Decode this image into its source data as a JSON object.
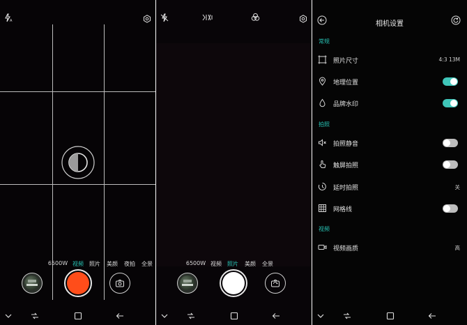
{
  "viewfinder_left": {
    "modes": [
      "6500W",
      "视频",
      "照片",
      "美颜",
      "夜拍",
      "全景"
    ],
    "active_mode": "视频",
    "shutter_color": "#ff4d1a",
    "flash_icon": "flash-auto-icon",
    "settings_icon": "settings-icon",
    "center_icon": "exposure-lock-icon",
    "side_icon": "camera-icon"
  },
  "viewfinder_right": {
    "modes": [
      "6500W",
      "视频",
      "照片",
      "美颜",
      "全景"
    ],
    "active_mode": "照片",
    "shutter_color": "#ffffff",
    "flash_icon": "flash-off-icon",
    "top_center_icon": "ai-scene-icon",
    "filter_icon": "filter-icon",
    "settings_icon": "settings-icon",
    "side_icon": "switch-camera-icon"
  },
  "settings": {
    "title": "相机设置",
    "back_icon": "back-arrow-icon",
    "reset_icon": "reset-icon",
    "sections": [
      {
        "title": "常规",
        "items": [
          {
            "label": "照片尺寸",
            "icon": "photo-size-icon",
            "value": "4:3 13M"
          },
          {
            "label": "地理位置",
            "icon": "location-icon",
            "toggle": true
          },
          {
            "label": "品牌水印",
            "icon": "watermark-icon",
            "toggle": true
          }
        ]
      },
      {
        "title": "拍照",
        "items": [
          {
            "label": "拍照静音",
            "icon": "mute-icon",
            "toggle": false
          },
          {
            "label": "触屏拍照",
            "icon": "touch-icon",
            "toggle": false
          },
          {
            "label": "延时拍照",
            "icon": "timer-icon",
            "value": "关"
          },
          {
            "label": "网格线",
            "icon": "grid-icon",
            "toggle": false
          }
        ]
      },
      {
        "title": "视频",
        "items": [
          {
            "label": "视频画质",
            "icon": "video-quality-icon",
            "value": "高"
          }
        ]
      }
    ]
  },
  "navbar": {
    "icons": [
      "collapse-icon",
      "recents-icon",
      "home-icon",
      "back-icon"
    ]
  }
}
